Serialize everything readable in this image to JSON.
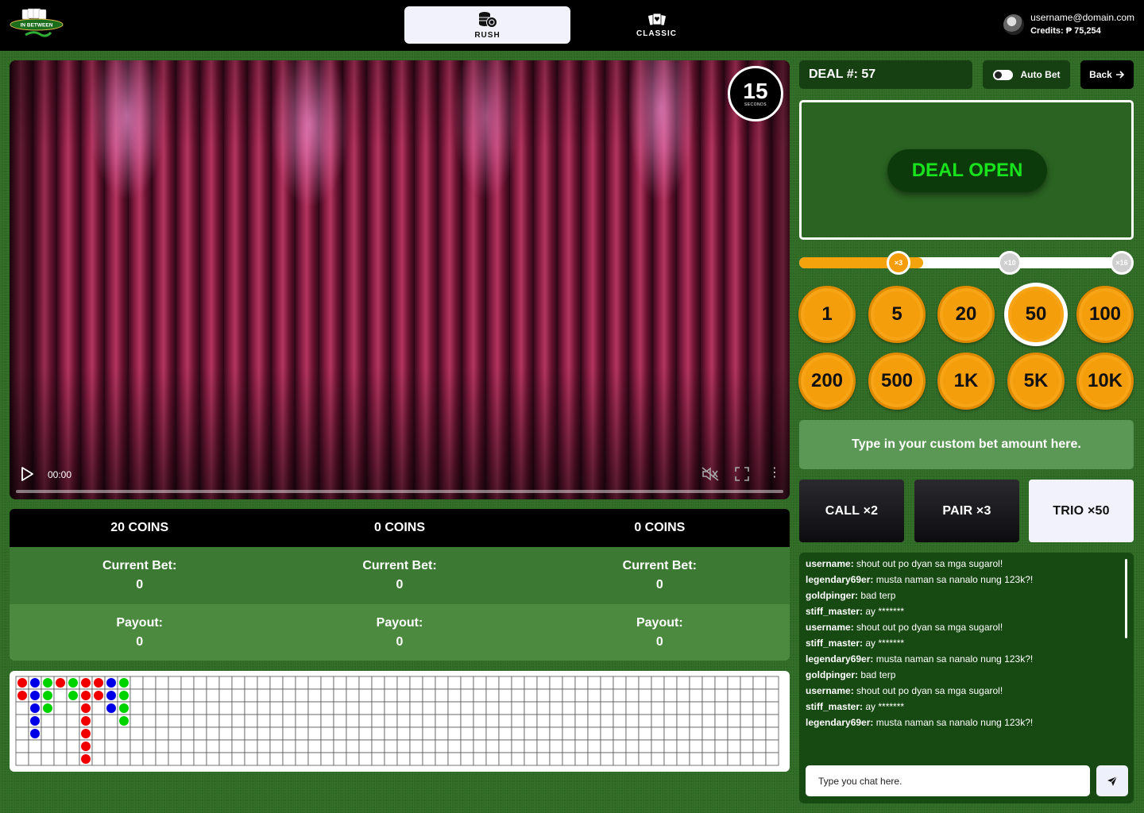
{
  "header": {
    "logo_text": "IN BETWEEN",
    "tabs": [
      {
        "label": "RUSH",
        "icon": "chips-icon",
        "active": true
      },
      {
        "label": "CLASSIC",
        "icon": "cards-icon",
        "active": false
      }
    ],
    "user": {
      "email": "username@domain.com",
      "credits": "Credits: ₱ 75,254"
    }
  },
  "video": {
    "timer": {
      "value": "15",
      "unit": "SECONDS"
    },
    "time": "00:00",
    "progress": 0
  },
  "bet_table": {
    "columns": [
      {
        "coins": "20 COINS",
        "current_bet_label": "Current Bet:",
        "current_bet": "0",
        "payout_label": "Payout:",
        "payout": "0"
      },
      {
        "coins": "0 COINS",
        "current_bet_label": "Current Bet:",
        "current_bet": "0",
        "payout_label": "Payout:",
        "payout": "0"
      },
      {
        "coins": "0 COINS",
        "current_bet_label": "Current Bet:",
        "current_bet": "0",
        "payout_label": "Payout:",
        "payout": "0"
      }
    ]
  },
  "roadmap": {
    "columns": 60,
    "rows": 7,
    "colors": {
      "r": "#f00000",
      "b": "#0000e6",
      "g": "#00d400"
    },
    "beads": [
      [
        "r",
        "r"
      ],
      [
        "b",
        "b",
        "b",
        "b",
        "b"
      ],
      [
        "g",
        "g",
        "g"
      ],
      [
        "r"
      ],
      [
        "g",
        "g"
      ],
      [
        "r",
        "r",
        "r",
        "r",
        "r",
        "r",
        "r"
      ],
      [
        "r",
        "r"
      ],
      [
        "b",
        "b",
        "b"
      ],
      [
        "g",
        "g",
        "g",
        "g"
      ]
    ]
  },
  "controls": {
    "deal_label": "DEAL #: 57",
    "auto_bet_label": "Auto Bet",
    "auto_bet_on": false,
    "back_label": "Back",
    "deal_status": "DEAL OPEN",
    "multiplier_level": 0.37,
    "multipliers": [
      "×3",
      "×10",
      "×16"
    ],
    "chips": [
      "1",
      "5",
      "20",
      "50",
      "100",
      "200",
      "500",
      "1K",
      "5K",
      "10K"
    ],
    "selected_chip": "50",
    "custom_bet_placeholder": "Type in your custom bet amount here.",
    "bet_buttons": [
      "CALL ×2",
      "PAIR  ×3",
      "TRIO ×50"
    ]
  },
  "chat": {
    "messages": [
      {
        "user": "username:",
        "text": " shout out po dyan sa mga sugarol!"
      },
      {
        "user": "legendary69er:",
        "text": " musta naman sa nanalo nung 123k?!"
      },
      {
        "user": "goldpinger:",
        "text": " bad terp"
      },
      {
        "user": "stiff_master:",
        "text": " ay *******"
      },
      {
        "user": "username:",
        "text": " shout out po dyan sa mga sugarol!"
      },
      {
        "user": "stiff_master:",
        "text": " ay *******"
      },
      {
        "user": "legendary69er:",
        "text": " musta naman sa nanalo nung 123k?!"
      },
      {
        "user": "goldpinger:",
        "text": " bad terp"
      },
      {
        "user": "username:",
        "text": " shout out po dyan sa mga sugarol!"
      },
      {
        "user": "stiff_master:",
        "text": " ay *******"
      },
      {
        "user": "legendary69er:",
        "text": " musta naman sa nanalo nung 123k?!"
      }
    ],
    "input_placeholder": "Type you chat here."
  }
}
